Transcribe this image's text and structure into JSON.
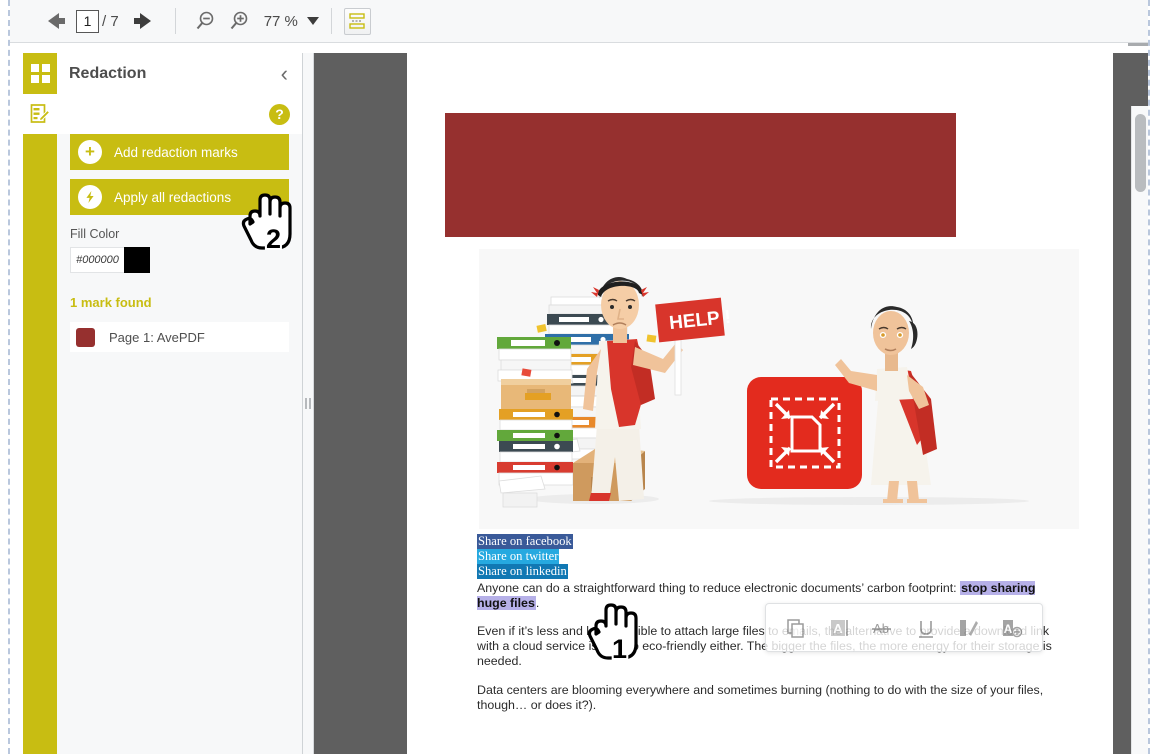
{
  "toolbar": {
    "prev_label": "previous-page",
    "next_label": "next-page",
    "page_current": "1",
    "page_total": "/ 7",
    "zoom_out_label": "zoom-out",
    "zoom_in_label": "zoom-in",
    "zoom_level": "77 %",
    "fit_label": "fit-page"
  },
  "rail": {
    "thumbnails_label": "thumbnails",
    "redaction_tool_label": "redaction"
  },
  "panel": {
    "title": "Redaction",
    "collapse_label": "‹",
    "help_label": "?",
    "add_marks_label": "Add redaction marks",
    "add_marks_icon": "plus-circle-icon",
    "apply_all_label": "Apply all redactions",
    "apply_all_icon": "bolt-circle-icon",
    "fill_color_label": "Fill Color",
    "fill_color_value": "#000000",
    "fill_color_swatch": "#000000",
    "marks_found": "1 mark found",
    "marks": [
      {
        "label": "Page 1: AvePDF",
        "color": "#96302f"
      }
    ],
    "accent_color": "#c8bd12"
  },
  "document": {
    "redaction_mark_color": "#96302f",
    "share_links": [
      {
        "label": "Share on facebook",
        "highlight": "#3a5a99"
      },
      {
        "label": "Share on twitter",
        "highlight": "#26a9e0"
      },
      {
        "label": "Share on linkedin",
        "highlight": "#1178b3"
      }
    ],
    "paragraph_1_before": "Anyone can do a straightforward thing to reduce electronic documents’ carbon footprint: ",
    "paragraph_1_highlight": "stop sharing huge files",
    "paragraph_1_after": ".",
    "paragraph_2": "Even if it’s less and less possible to attach large files to emails, the alternative to provide a download link with a cloud service is not too eco-friendly either. The bigger the files, the more energy for their storage is needed.",
    "paragraph_3": "Data centers are blooming everywhere and sometimes burning (nothing to do with the size of your files, though… or does it?).",
    "illustration_sign": "HELP !"
  },
  "float_toolbar": {
    "buttons": [
      {
        "name": "copy-icon",
        "label": "Copy"
      },
      {
        "name": "highlight-icon",
        "label": "Highlight"
      },
      {
        "name": "strikethrough-icon",
        "label": "Strikethrough"
      },
      {
        "name": "underline-icon",
        "label": "Underline"
      },
      {
        "name": "squiggly-icon",
        "label": "Squiggly"
      },
      {
        "name": "redact-icon",
        "label": "Redact"
      }
    ]
  },
  "cursors": [
    {
      "number": "1"
    },
    {
      "number": "2"
    }
  ]
}
